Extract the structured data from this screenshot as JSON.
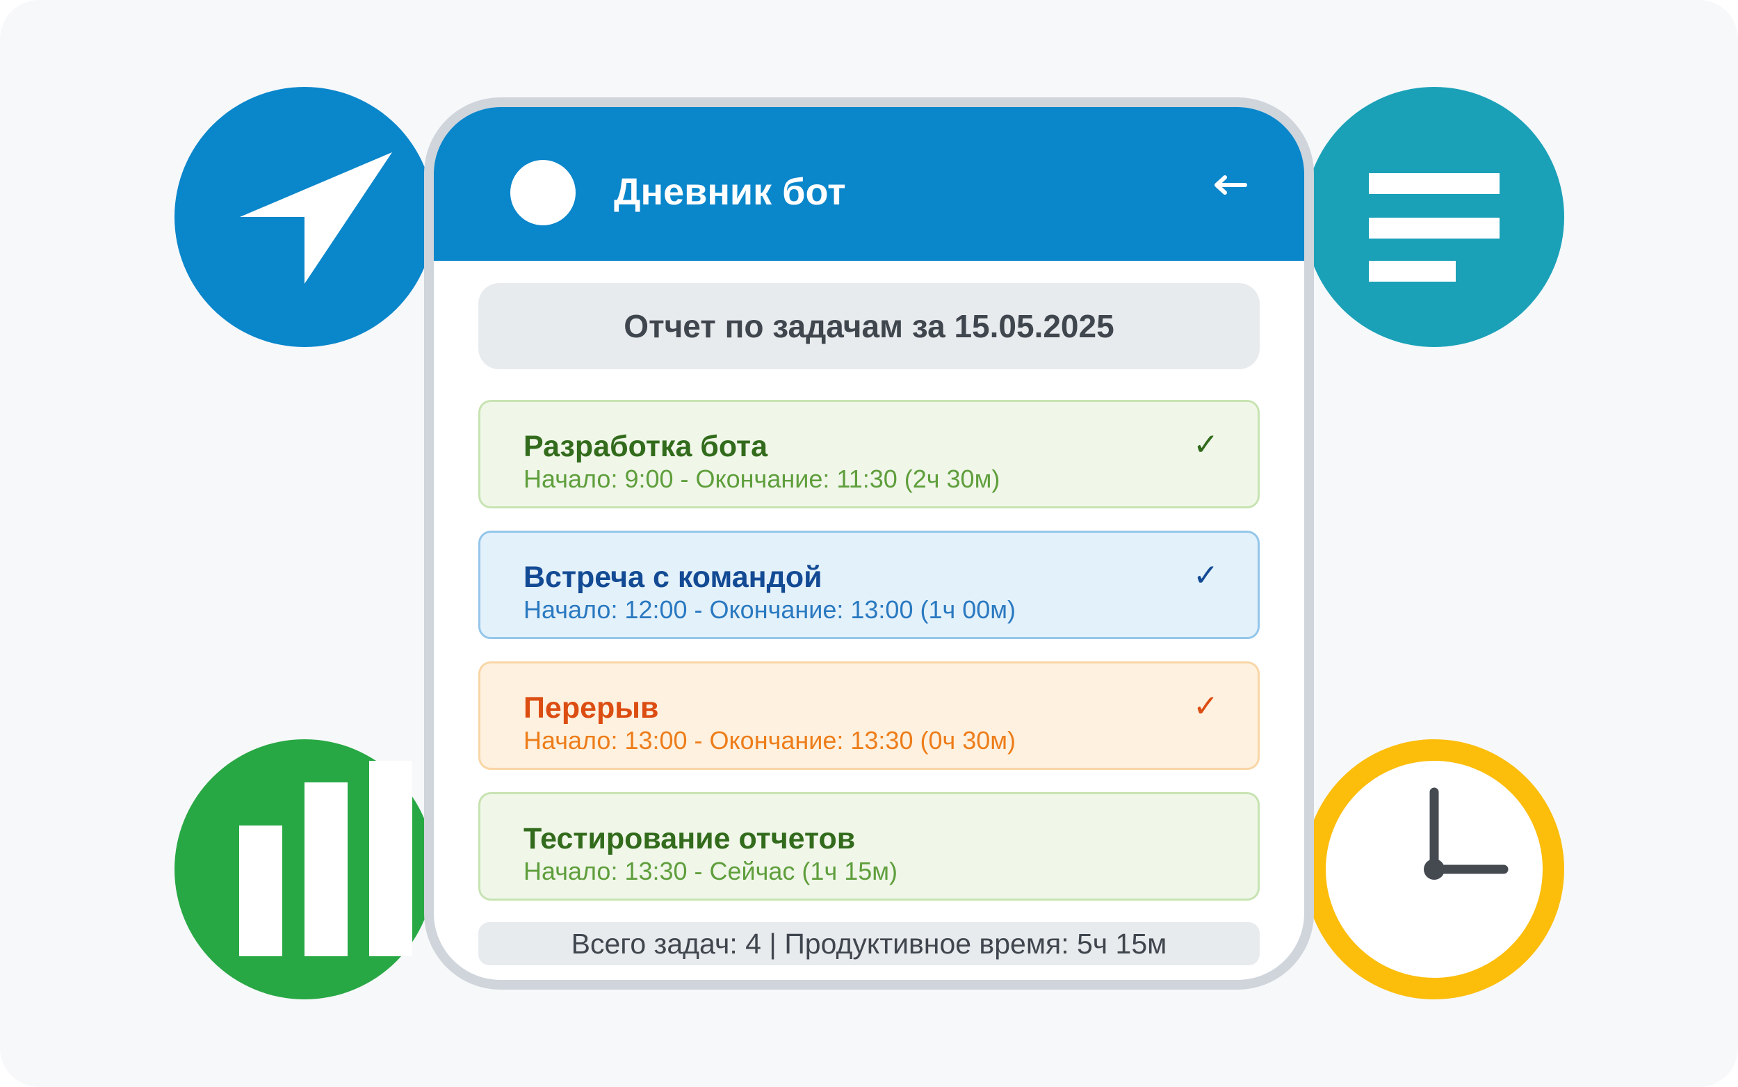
{
  "colors": {
    "header": "#0a86cb",
    "nav_circle": "#0a86cb",
    "menu_circle": "#1aa1b8",
    "chart_circle": "#28a844",
    "clock_ring": "#fcbd0b"
  },
  "icons": {
    "nav": "navigation-arrow-icon",
    "menu": "menu-lines-icon",
    "chart": "bar-chart-icon",
    "clock": "clock-icon",
    "back": "reply-arrow-icon",
    "avatar": "bot-avatar"
  },
  "header": {
    "title": "Дневник бот",
    "back_symbol": "↩"
  },
  "report": {
    "title": "Отчет по задачам за 15.05.2025"
  },
  "tasks": [
    {
      "name": "Разработка бота",
      "time": "Начало: 9:00 - Окончание: 11:30 (2ч 30м)",
      "check": "✓",
      "status": "done",
      "color": "green"
    },
    {
      "name": "Встреча с командой",
      "time": "Начало: 12:00 - Окончание: 13:00 (1ч 00м)",
      "check": "✓",
      "status": "done",
      "color": "blue"
    },
    {
      "name": "Перерыв",
      "time": "Начало: 13:00 - Окончание: 13:30 (0ч 30м)",
      "check": "✓",
      "status": "done",
      "color": "orange"
    },
    {
      "name": "Тестирование отчетов",
      "time": "Начало: 13:30 - Сейчас (1ч 15м)",
      "check": "",
      "status": "in-progress",
      "color": "green"
    }
  ],
  "summary": {
    "text": "Всего задач: 4 | Продуктивное время: 5ч 15м"
  }
}
